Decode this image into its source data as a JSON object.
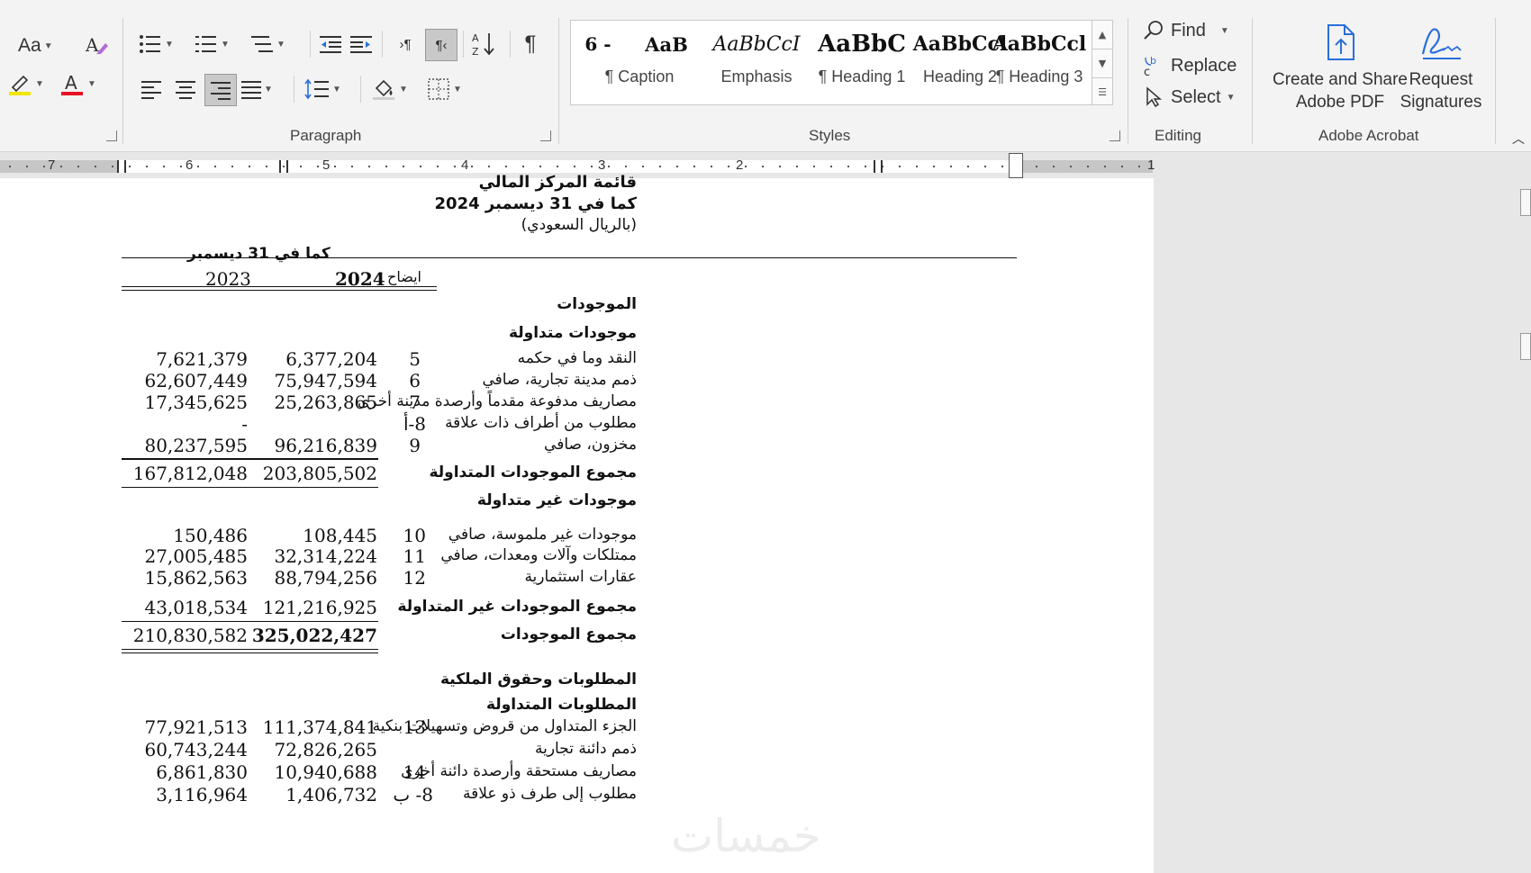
{
  "ribbon": {
    "groups": {
      "paragraph": "Paragraph",
      "styles": "Styles",
      "editing": "Editing",
      "adobe": "Adobe Acrobat"
    },
    "font": {
      "change_case_label": "Aa"
    },
    "styles_gallery": [
      {
        "sample": "6 -",
        "name": ""
      },
      {
        "sample": "AaB",
        "name": "¶ Caption"
      },
      {
        "sample": "AaBbCcI",
        "name": "Emphasis"
      },
      {
        "sample": "AaBbC",
        "name": "¶ Heading 1"
      },
      {
        "sample": "AaBbCcl",
        "name": "Heading 2"
      },
      {
        "sample": "AaBbCcl",
        "name": "¶ Heading 3"
      }
    ],
    "editing": {
      "find": "Find",
      "replace": "Replace",
      "select": "Select"
    },
    "adobe": {
      "create_share_line1": "Create and Share",
      "create_share_line2": "Adobe PDF",
      "request_line1": "Request",
      "request_line2": "Signatures"
    },
    "colors": {
      "highlight": "#f2e600",
      "font_color": "#e81123",
      "acrobat_blue": "#2a6fdb"
    }
  },
  "ruler": {
    "numbers": [
      "7",
      "6",
      "5",
      "4",
      "3",
      "2",
      "1"
    ]
  },
  "document": {
    "title": "قائمة المركز المالي",
    "subtitle": "كما في 31 ديسمبر 2024",
    "currency": "(بالريال السعودي)",
    "col_group": "كما في 31 ديسمبر",
    "col_notes": "ايضاح",
    "col_2024": "2024",
    "col_2023": "2023",
    "assets_heading": "الموجودات",
    "current_assets_heading": "موجودات متداولة",
    "current_assets": [
      {
        "label": "النقد وما في حكمه",
        "note": "5",
        "v2024": "6,377,204",
        "v2023": "7,621,379"
      },
      {
        "label": "ذمم مدينة تجارية، صافي",
        "note": "6",
        "v2024": "75,947,594",
        "v2023": "62,607,449"
      },
      {
        "label": "مصاريف مدفوعة مقدماً وأرصدة مدينة أخرى",
        "note": "7",
        "v2024": "25,263,865",
        "v2023": "17,345,625"
      },
      {
        "label": "مطلوب من أطراف ذات علاقة",
        "note": "8-أ",
        "v2024": "",
        "v2023": "-"
      },
      {
        "label": "مخزون، صافي",
        "note": "9",
        "v2024": "96,216,839",
        "v2023": "80,237,595"
      }
    ],
    "total_current_assets": {
      "label": "مجموع الموجودات المتداولة",
      "v2024": "203,805,502",
      "v2023": "167,812,048"
    },
    "noncurrent_heading": "موجودات غير متداولة",
    "noncurrent_assets": [
      {
        "label": "موجودات غير ملموسة، صافي",
        "note": "10",
        "v2024": "108,445",
        "v2023": "150,486"
      },
      {
        "label": "ممتلكات وآلات ومعدات، صافي",
        "note": "11",
        "v2024": "32,314,224",
        "v2023": "27,005,485"
      },
      {
        "label": "عقارات استثمارية",
        "note": "12",
        "v2024": "88,794,256",
        "v2023": "15,862,563"
      }
    ],
    "total_noncurrent": {
      "label": "مجموع الموجودات غير المتداولة",
      "v2024": "121,216,925",
      "v2023": "43,018,534"
    },
    "total_assets": {
      "label": "مجموع الموجودات",
      "v2024": "325,022,427",
      "v2023": "210,830,582"
    },
    "liab_heading": "المطلوبات وحقوق الملكية",
    "current_liab_heading": "المطلوبات المتداولة",
    "current_liabilities": [
      {
        "label": "الجزء المتداول من قروض وتسهيلات بنكية",
        "note": "13",
        "v2024": "111,374,841",
        "v2023": "77,921,513"
      },
      {
        "label": "ذمم دائنة تجارية",
        "note": "",
        "v2024": "72,826,265",
        "v2023": "60,743,244"
      },
      {
        "label": "مصاريف مستحقة وأرصدة دائنة أخرى",
        "note": "14",
        "v2024": "10,940,688",
        "v2023": "6,861,830"
      },
      {
        "label": "مطلوب إلى طرف ذو علاقة",
        "note": "8- ب",
        "v2024": "1,406,732",
        "v2023": "3,116,964"
      }
    ]
  },
  "watermark": "خمسات"
}
